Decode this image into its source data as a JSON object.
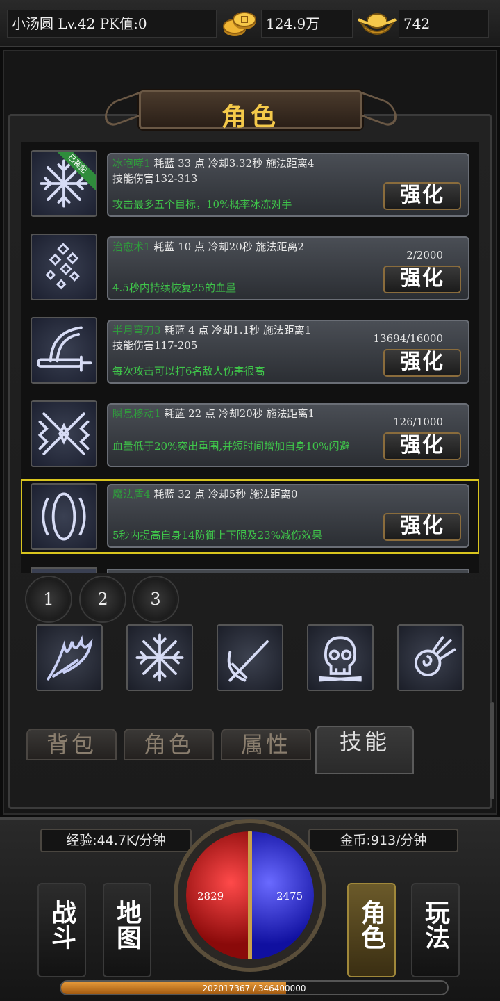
{
  "topbar": {
    "player": "小汤圆  Lv.42 PK值:0",
    "gold": "124.9万",
    "ingot": "742"
  },
  "panel": {
    "title": "角色"
  },
  "equip_tag": "已装配",
  "skills": [
    {
      "name": "冰咆哮1",
      "stats": " 耗蓝 33 点   冷却3.32秒  施法距离4",
      "damage": "技能伤害132-313",
      "desc": "攻击最多五个目标，10%概率冰冻对手",
      "progress": "",
      "button": "强化",
      "icon": "snowflake-icon"
    },
    {
      "name": "治愈术1",
      "stats": " 耗蓝 10 点   冷却20秒 施法距离2",
      "damage": "",
      "desc": "4.5秒内持续恢复25的血量",
      "progress": "2/2000",
      "button": "强化",
      "icon": "healing-icon"
    },
    {
      "name": "半月弯刀3",
      "stats": " 耗蓝 4 点  冷却1.1秒   施法距离1",
      "damage": "技能伤害117-205",
      "desc": "每次攻击可以打6名敌人伤害很高",
      "progress": "13694/16000",
      "button": "强化",
      "icon": "crescent-blade-icon"
    },
    {
      "name": "瞬息移动1",
      "stats": " 耗蓝 22 点    冷却20秒 施法距离1",
      "damage": "",
      "desc": "血量低于20%突出重围,并短时间增加自身10%闪避",
      "progress": "126/1000",
      "button": "强化",
      "icon": "teleport-icon"
    },
    {
      "name": "魔法盾4",
      "stats": " 耗蓝 32 点    冷却5秒  施法距离0",
      "damage": "",
      "desc": "5秒内提高自身14防御上下限及23%减伤效果",
      "progress": "",
      "button": "强化",
      "icon": "magic-shield-icon"
    }
  ],
  "pages": [
    "1",
    "2",
    "3"
  ],
  "slots": [
    "flame-claw-icon",
    "snowflake-icon",
    "sword-icon",
    "skull-icon",
    "fireball-icon"
  ],
  "tabs": [
    "背包",
    "角色",
    "属性",
    "技能"
  ],
  "active_tab": "技能",
  "hud": {
    "exp_rate": "经验:44.7K/分钟",
    "gold_rate": "金币:913/分钟",
    "hp": "2829",
    "mp": "2475",
    "xp_text": "202017367 / 346400000",
    "xp_fraction": 0.583,
    "menu": [
      "战斗",
      "地图",
      "角色",
      "玩法"
    ],
    "active_menu": "角色"
  },
  "colors": {
    "skill_name": "#2f9c3c",
    "desc": "#3fc64a",
    "title": "#f4c94a",
    "selected_outline": "#d9c51e"
  }
}
